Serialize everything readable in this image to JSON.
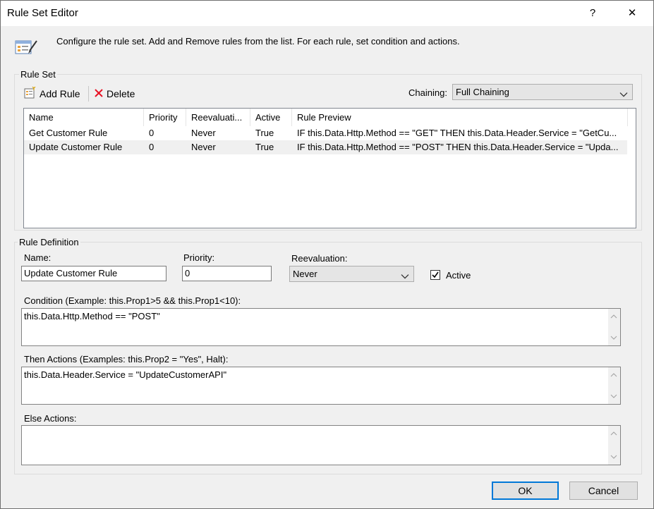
{
  "window": {
    "title": "Rule Set Editor",
    "help_glyph": "?",
    "close_glyph": "✕"
  },
  "header": {
    "description": "Configure the rule set. Add and Remove rules from the list. For each rule, set condition and actions."
  },
  "rule_set": {
    "group_label": "Rule Set",
    "add_rule_label": "Add Rule",
    "delete_label": "Delete",
    "chaining_label": "Chaining:",
    "chaining_value": "Full Chaining",
    "columns": [
      "Name",
      "Priority",
      "Reevaluati...",
      "Active",
      "Rule Preview"
    ],
    "rows": [
      {
        "name": "Get Customer Rule",
        "priority": "0",
        "reevaluation": "Never",
        "active": "True",
        "preview": "IF this.Data.Http.Method == \"GET\" THEN this.Data.Header.Service = \"GetCu..."
      },
      {
        "name": "Update Customer Rule",
        "priority": "0",
        "reevaluation": "Never",
        "active": "True",
        "preview": "IF this.Data.Http.Method == \"POST\" THEN this.Data.Header.Service = \"Upda..."
      }
    ],
    "selected_row_index": 1
  },
  "rule_definition": {
    "group_label": "Rule Definition",
    "name_label": "Name:",
    "name_value": "Update Customer Rule",
    "priority_label": "Priority:",
    "priority_value": "0",
    "reevaluation_label": "Reevaluation:",
    "reevaluation_value": "Never",
    "active_label": "Active",
    "active_checked": true,
    "condition_label": "Condition (Example: this.Prop1>5 && this.Prop1<10):",
    "condition_value": "this.Data.Http.Method == \"POST\"",
    "then_label": "Then Actions (Examples: this.Prop2 = \"Yes\", Halt):",
    "then_value": "this.Data.Header.Service = \"UpdateCustomerAPI\"",
    "else_label": "Else Actions:",
    "else_value": ""
  },
  "footer": {
    "ok_label": "OK",
    "cancel_label": "Cancel"
  },
  "colors": {
    "accent": "#0078d7",
    "delete_red": "#e81123",
    "selected_row": "#f0f0f0"
  }
}
